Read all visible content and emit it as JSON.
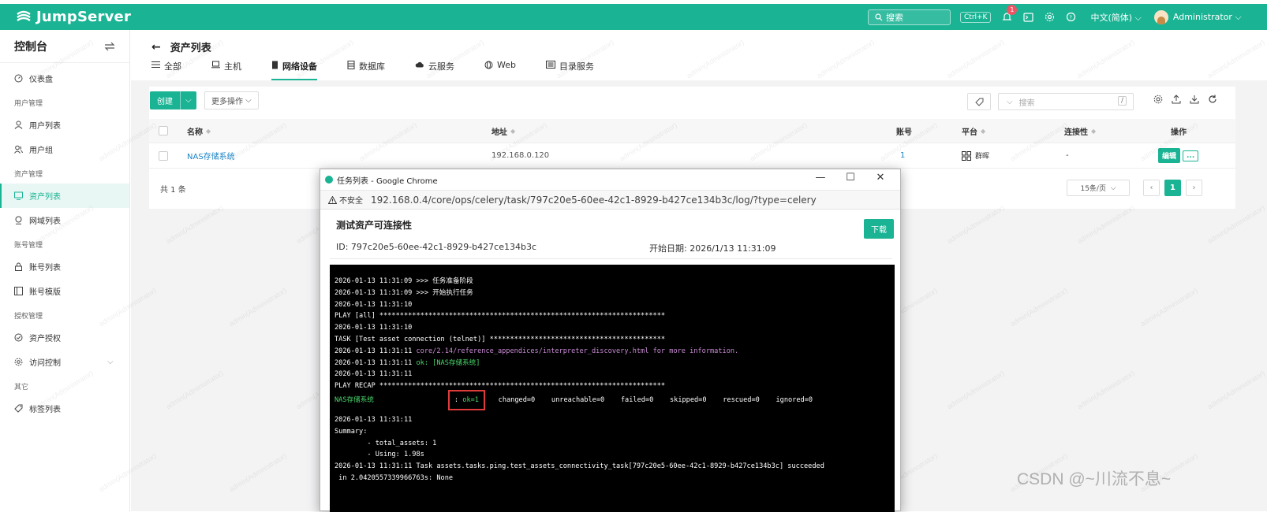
{
  "app": {
    "name": "JumpServer"
  },
  "topbar": {
    "search_placeholder": "搜索",
    "shortcut": "Ctrl+K",
    "notification_count": "1",
    "language": "中文(简体)",
    "username": "Administrator"
  },
  "sidebar": {
    "title": "控制台",
    "groups": [
      {
        "label": "",
        "items": [
          {
            "label": "仪表盘",
            "icon": "dashboard-icon"
          }
        ]
      },
      {
        "label": "用户管理",
        "items": [
          {
            "label": "用户列表",
            "icon": "user-icon"
          },
          {
            "label": "用户组",
            "icon": "users-icon"
          }
        ]
      },
      {
        "label": "资产管理",
        "items": [
          {
            "label": "资产列表",
            "icon": "monitor-icon",
            "active": true
          },
          {
            "label": "网域列表",
            "icon": "network-icon"
          }
        ]
      },
      {
        "label": "账号管理",
        "items": [
          {
            "label": "账号列表",
            "icon": "lock-icon"
          },
          {
            "label": "账号模版",
            "icon": "template-icon"
          }
        ]
      },
      {
        "label": "授权管理",
        "items": [
          {
            "label": "资产授权",
            "icon": "check-circle-icon"
          },
          {
            "label": "访问控制",
            "icon": "gear-icon"
          }
        ]
      },
      {
        "label": "其它",
        "items": [
          {
            "label": "标签列表",
            "icon": "tag-icon"
          }
        ]
      }
    ]
  },
  "page": {
    "title": "资产列表",
    "tabs": [
      {
        "label": "全部",
        "icon": "list-icon"
      },
      {
        "label": "主机",
        "icon": "laptop-icon"
      },
      {
        "label": "网络设备",
        "icon": "router-icon",
        "active": true
      },
      {
        "label": "数据库",
        "icon": "database-icon"
      },
      {
        "label": "云服务",
        "icon": "cloud-icon"
      },
      {
        "label": "Web",
        "icon": "globe-icon"
      },
      {
        "label": "目录服务",
        "icon": "directory-icon"
      }
    ]
  },
  "toolbar": {
    "create_label": "创建",
    "more_label": "更多操作",
    "search_placeholder": "搜索",
    "search_shortcut": "/"
  },
  "table": {
    "headers": {
      "name": "名称",
      "address": "地址",
      "accounts": "账号",
      "platform": "平台",
      "connectivity": "连接性",
      "actions": "操作"
    },
    "rows": [
      {
        "name": "NAS存储系统",
        "address": "192.168.0.120",
        "accounts": "1",
        "platform": "群晖",
        "connectivity": "-",
        "edit": "编辑",
        "more": "..."
      }
    ],
    "total": "共 1 条",
    "page_size": "15条/页",
    "current_page": "1"
  },
  "popup": {
    "window_title": "任务列表 - Google Chrome",
    "insecure_label": "不安全",
    "url": "192.168.0.4/core/ops/celery/task/797c20e5-60ee-42c1-8929-b427ce134b3c/log/?type=celery",
    "task_title": "测试资产可连接性",
    "download_label": "下载",
    "id_label": "ID: 797c20e5-60ee-42c1-8929-b427ce134b3c",
    "date_label": "开始日期: 2026/1/13 11:31:09",
    "log": {
      "l1": "2026-01-13 11:31:09 >>> 任务准备阶段",
      "l2": "2026-01-13 11:31:09 >>> 开始执行任务",
      "l3": "2026-01-13 11:31:10",
      "l4": "PLAY [all] **********************************************************************",
      "l5": "2026-01-13 11:31:10",
      "l6": "TASK [Test asset connection (telnet)] *******************************************",
      "l7_ts": "2026-01-13 11:31:11 ",
      "l7_msg": "core/2.14/reference_appendices/interpreter_discovery.html for more information.",
      "l8_ts": "2026-01-13 11:31:11 ",
      "l8_msg": "ok: [NAS存储系统]",
      "l9": "2026-01-13 11:31:11",
      "l10": "PLAY RECAP **********************************************************************",
      "recap_host": "NAS存储系统",
      "recap_colon": ": ",
      "recap_ok": "ok=1",
      "recap_rest": "    changed=0    unreachable=0    failed=0    skipped=0    rescued=0    ignored=0",
      "l12": "2026-01-13 11:31:11",
      "l13": "Summary:",
      "l14": "        - total_assets: 1",
      "l15": "        - Using: 1.98s",
      "l16": "2026-01-13 11:31:11 Task assets.tasks.ping.test_assets_connectivity_task[797c20e5-60ee-42c1-8929-b427ce134b3c] succeeded",
      "l17": " in 2.0420557339966763s: None"
    }
  },
  "watermarks": {
    "text": "admin(Administrator)",
    "credit": "CSDN @~川流不息~"
  },
  "colors": {
    "brand": "#1ab394",
    "link": "#1c84c6",
    "highlight": "#e03b3b"
  }
}
